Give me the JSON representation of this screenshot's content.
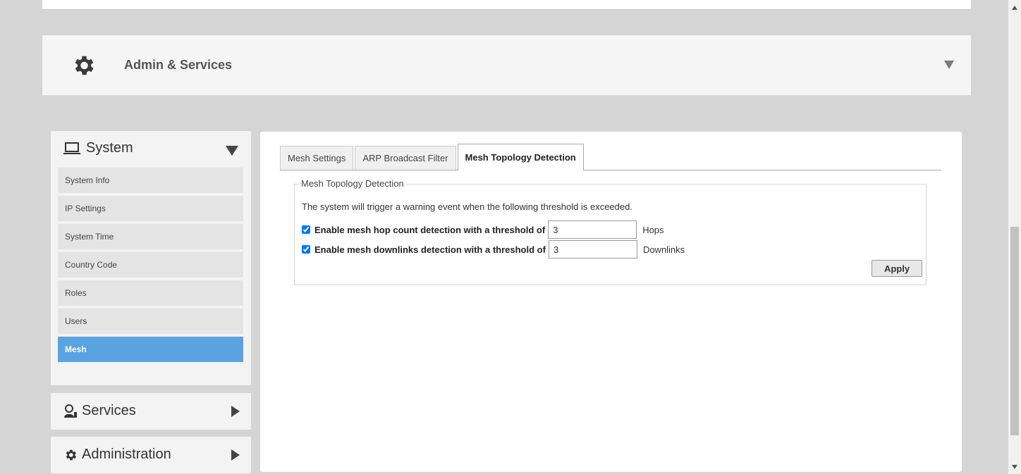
{
  "section": {
    "title": "Admin & Services",
    "icon": "gear-icon"
  },
  "sidebar": {
    "system": {
      "label": "System",
      "icon": "laptop-icon",
      "items": [
        {
          "label": "System Info",
          "active": false
        },
        {
          "label": "IP Settings",
          "active": false
        },
        {
          "label": "System Time",
          "active": false
        },
        {
          "label": "Country Code",
          "active": false
        },
        {
          "label": "Roles",
          "active": false
        },
        {
          "label": "Users",
          "active": false
        },
        {
          "label": "Mesh",
          "active": true
        }
      ]
    },
    "services": {
      "label": "Services",
      "icon": "services-icon"
    },
    "administration": {
      "label": "Administration",
      "icon": "gear-icon"
    }
  },
  "tabs": [
    {
      "label": "Mesh Settings",
      "active": false
    },
    {
      "label": "ARP Broadcast Filter",
      "active": false
    },
    {
      "label": "Mesh Topology Detection",
      "active": true
    }
  ],
  "form": {
    "legend": "Mesh Topology Detection",
    "description": "The system will trigger a warning event when the following threshold is exceeded.",
    "hop_count": {
      "label": "Enable mesh hop count detection with a threshold of",
      "checked": true,
      "value": "3",
      "unit": "Hops"
    },
    "downlinks": {
      "label": "Enable mesh downlinks detection with a threshold of",
      "checked": true,
      "value": "3",
      "unit": "Downlinks"
    },
    "apply_label": "Apply"
  },
  "colors": {
    "accent": "#5aa3e1",
    "page_bg": "#d5d5d5"
  }
}
